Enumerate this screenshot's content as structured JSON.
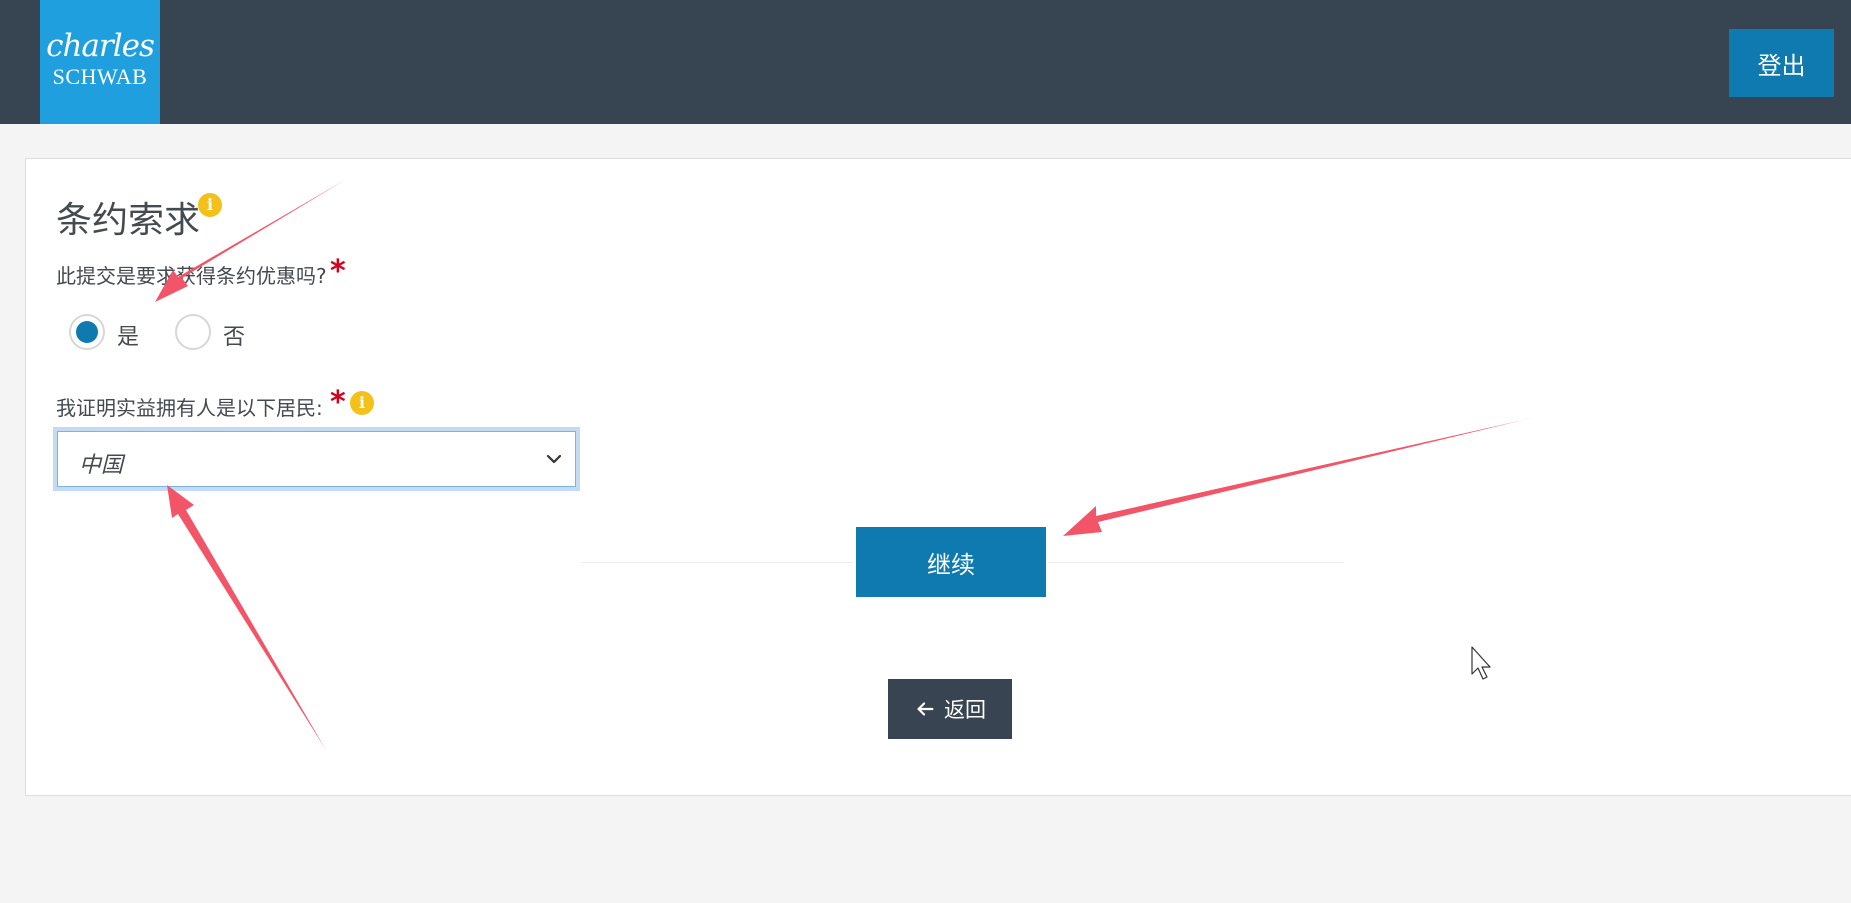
{
  "header": {
    "logo_line1": "charles",
    "logo_line2": "SCHWAB",
    "logout_label": "登出"
  },
  "form": {
    "title": "条约索求",
    "question": "此提交是要求获得条约优惠吗?",
    "required_mark": "*",
    "options": [
      {
        "label": "是",
        "selected": true
      },
      {
        "label": "否",
        "selected": false
      }
    ],
    "country_label": "我证明实益拥有人是以下居民:",
    "country_value": "中国",
    "info_glyph": "i"
  },
  "actions": {
    "continue_label": "继续",
    "back_label": "返回"
  },
  "colors": {
    "header_bg": "#374553",
    "logo_bg": "#1f9fde",
    "primary": "#0f7ab0",
    "back_bg": "#384451",
    "info": "#f3c11a",
    "required": "#d0021b",
    "annotation_arrow": "#f25567"
  },
  "icons": {
    "info": "info-icon",
    "chevron": "chevron-down-icon",
    "back": "arrow-left-icon",
    "cursor": "mouse-cursor-icon",
    "annotation": "annotation-arrow-icon"
  }
}
